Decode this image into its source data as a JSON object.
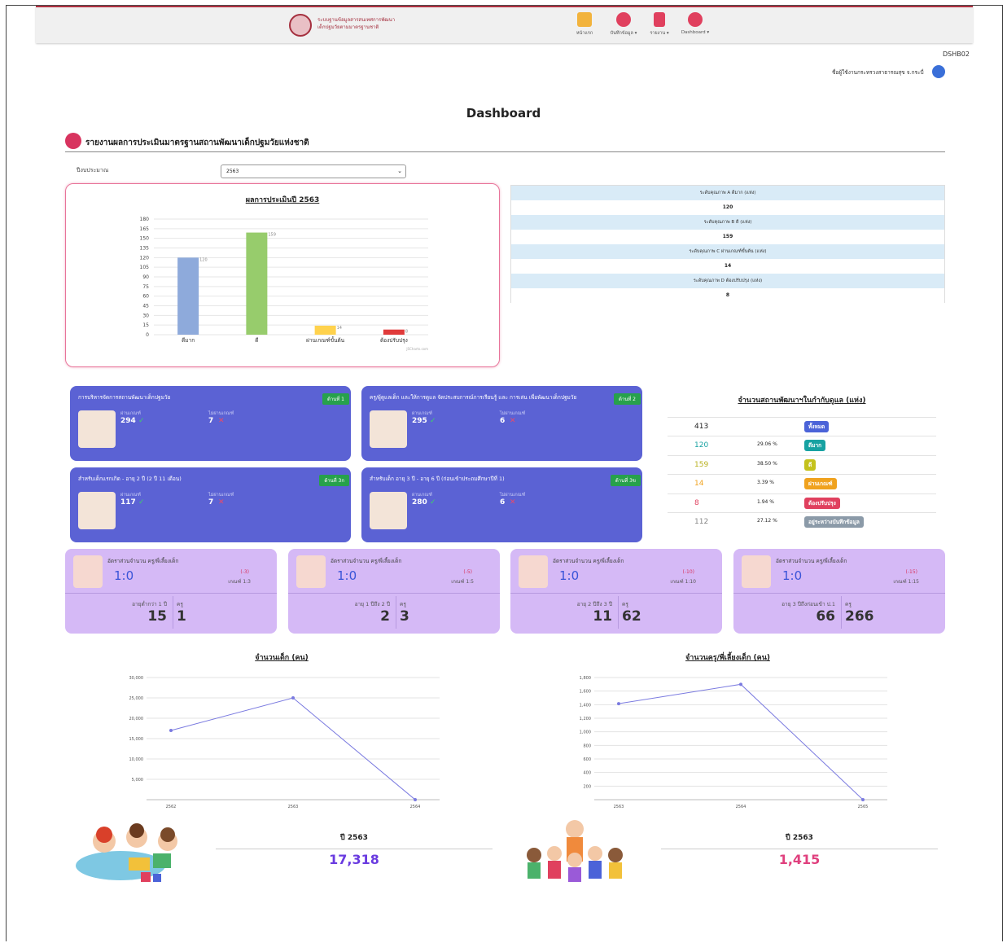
{
  "header": {
    "logo_line1": "ระบบฐานข้อมูลสารสนเทศการพัฒนา",
    "logo_line2": "เด็กปฐมวัยตามมาตรฐานชาติ",
    "nav": [
      {
        "label": "หน้าแรก",
        "icon": "home-icon"
      },
      {
        "label": "บันทึกข้อมูล ▾",
        "icon": "record-icon"
      },
      {
        "label": "รายงาน ▾",
        "icon": "report-icon"
      },
      {
        "label": "Dashboard ▾",
        "icon": "pie-chart-icon"
      }
    ]
  },
  "page_code": "DSHB02",
  "user_name": "ชื่อผู้ใช้งานกระทรวงสาธารณสุข จ.กระบี่",
  "title": "Dashboard",
  "section_title": "รายงานผลการประเมินมาตรฐานสถานพัฒนาเด็กปฐมวัยแห่งชาติ",
  "filter": {
    "label": "ปีงบประมาณ",
    "value": "2563"
  },
  "chart_card": {
    "title": "ผลการประเมินปี 2563",
    "credit": "JSCharts.com"
  },
  "chart_data": {
    "type": "bar",
    "categories": [
      "ดีมาก",
      "ดี",
      "ผ่านเกณฑ์ขั้นต้น",
      "ต้องปรับปรุง"
    ],
    "series": [
      {
        "values": [
          120,
          159,
          14,
          8
        ],
        "colors": [
          "#8eaadb",
          "#97cc6c",
          "#ffd24d",
          "#e03a3a"
        ]
      }
    ],
    "value_labels": [
      "120",
      "159",
      "14",
      "8"
    ],
    "yticks": [
      0,
      15,
      30,
      45,
      60,
      75,
      90,
      105,
      120,
      135,
      150,
      165,
      180
    ],
    "ylim": [
      0,
      180
    ]
  },
  "quality_table": [
    {
      "label": "ระดับคุณภาพ A ดีมาก (แห่ง)",
      "value": "120"
    },
    {
      "label": "ระดับคุณภาพ B ดี (แห่ง)",
      "value": "159"
    },
    {
      "label": "ระดับคุณภาพ C ผ่านเกณฑ์ขั้นต้น (แห่ง)",
      "value": "14"
    },
    {
      "label": "ระดับคุณภาพ D ต้องปรับปรุง (แห่ง)",
      "value": "8"
    }
  ],
  "domain_cards": [
    {
      "title": "การบริหารจัดการสถานพัฒนาเด็กปฐมวัย",
      "badge": "ด้านที่ 1",
      "pass_label": "ผ่านเกณฑ์",
      "pass": "294",
      "fail_label": "ไม่ผ่านเกณฑ์",
      "fail": "7"
    },
    {
      "title": "ครู/ผู้ดูแลเด็ก และให้การดูแล จัดประสบการณ์การเรียนรู้ และ การเล่น เพื่อพัฒนาเด็กปฐมวัย",
      "badge": "ด้านที่ 2",
      "pass_label": "ผ่านเกณฑ์",
      "pass": "295",
      "fail_label": "ไม่ผ่านเกณฑ์",
      "fail": "6"
    },
    {
      "title": "สำหรับเด็กแรกเกิด - อายุ 2 ปี (2 ปี 11 เดือน)",
      "badge": "ด้านที่ 3ก",
      "pass_label": "ผ่านเกณฑ์",
      "pass": "117",
      "fail_label": "ไม่ผ่านเกณฑ์",
      "fail": "7"
    },
    {
      "title": "สำหรับเด็ก อายุ 3 ปี - อายุ 6 ปี (ก่อนเข้าประถมศึกษาปีที่ 1)",
      "badge": "ด้านที่ 3ข",
      "pass_label": "ผ่านเกณฑ์",
      "pass": "280",
      "fail_label": "ไม่ผ่านเกณฑ์",
      "fail": "6"
    }
  ],
  "count_panel": {
    "title": "จำนวนสถานพัฒนาฯในกำกับดูแล (แห่ง)",
    "rows": [
      {
        "num": "413",
        "pct": "",
        "badge": "ทั้งหมด",
        "color": "#4b63d8",
        "num_color": "#222"
      },
      {
        "num": "120",
        "pct": "29.06 %",
        "badge": "ดีมาก",
        "color": "#17a2a2",
        "num_color": "#17a2a2"
      },
      {
        "num": "159",
        "pct": "38.50 %",
        "badge": "ดี",
        "color": "#c4c21c",
        "num_color": "#b8b01c"
      },
      {
        "num": "14",
        "pct": "3.39 %",
        "badge": "ผ่านเกณฑ์",
        "color": "#f0a21e",
        "num_color": "#f0a21e"
      },
      {
        "num": "8",
        "pct": "1.94 %",
        "badge": "ต้องปรับปรุง",
        "color": "#e0405e",
        "num_color": "#e0405e"
      },
      {
        "num": "112",
        "pct": "27.12 %",
        "badge": "อยู่ระหว่างบันทึกข้อมูล",
        "color": "#8b9aa8",
        "num_color": "#888"
      }
    ]
  },
  "ratio_cards": [
    {
      "title": "อัตราส่วนจำนวน ครู/พี่เลี้ยงเด็ก",
      "ratio": "1:0",
      "diff": "(-3)",
      "std": "เกณฑ์ 1:3",
      "age_label": "อายุต่ำกว่า 1 ปี",
      "kids": "15",
      "teacher_label": "ครู",
      "teachers": "1"
    },
    {
      "title": "อัตราส่วนจำนวน ครู/พี่เลี้ยงเด็ก",
      "ratio": "1:0",
      "diff": "(-5)",
      "std": "เกณฑ์ 1:5",
      "age_label": "อายุ 1 ปีถึง 2 ปี",
      "kids": "2",
      "teacher_label": "ครู",
      "teachers": "3"
    },
    {
      "title": "อัตราส่วนจำนวน ครู/พี่เลี้ยงเด็ก",
      "ratio": "1:0",
      "diff": "(-10)",
      "std": "เกณฑ์ 1:10",
      "age_label": "อายุ 2 ปีถึง 3 ปี",
      "kids": "11",
      "teacher_label": "ครู",
      "teachers": "62"
    },
    {
      "title": "อัตราส่วนจำนวน ครู/พี่เลี้ยงเด็ก",
      "ratio": "1:0",
      "diff": "(-15)",
      "std": "เกณฑ์ 1:15",
      "age_label": "อายุ 3 ปีถึงก่อนเข้า ป.1",
      "kids": "66",
      "teacher_label": "ครู",
      "teachers": "266"
    }
  ],
  "kids_chart": {
    "title": "จำนวนเด็ก (คน)",
    "chart_data": {
      "type": "line",
      "x": [
        "2562",
        "2563",
        "2564"
      ],
      "y": [
        17000,
        25000,
        0
      ],
      "yticks": [
        "5,000",
        "10,000",
        "15,000",
        "20,000",
        "25,000",
        "30,000"
      ],
      "ylim": [
        0,
        30000
      ]
    },
    "year_label": "ปี 2563",
    "total": "17,318"
  },
  "teachers_chart": {
    "title": "จำนวนครู/พี่เลี้ยงเด็ก (คน)",
    "chart_data": {
      "type": "line",
      "x": [
        "2563",
        "2564",
        "2565"
      ],
      "y": [
        1415,
        1700,
        0
      ],
      "yticks": [
        "200",
        "400",
        "600",
        "800",
        "1,000",
        "1,200",
        "1,400",
        "1,600",
        "1,800"
      ],
      "ylim": [
        0,
        1800
      ]
    },
    "year_label": "ปี 2563",
    "total": "1,415"
  },
  "colors": {
    "accent": "#d8345f",
    "card_blue": "#5b62d4",
    "card_purple": "#d5b9f6",
    "kids_total": "#6a3be0",
    "teachers_total": "#e0407e"
  }
}
